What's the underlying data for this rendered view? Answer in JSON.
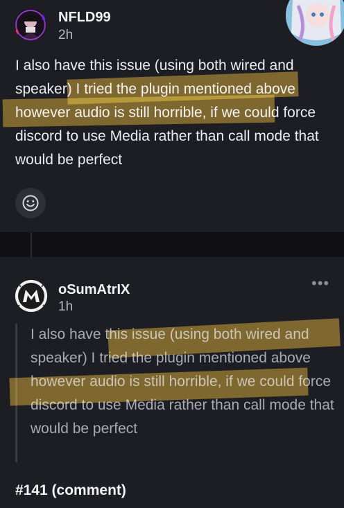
{
  "post1": {
    "username": "NFLD99",
    "time": "2h",
    "body": "I also have this issue (using both wired and speaker) I tried the plugin mentioned above however audio is still horrible, if we could force discord to use Media rather than call mode that would be perfect"
  },
  "post2": {
    "username": "oSumAtrIX",
    "time": "1h",
    "quote": "I also have this issue (using both wired and speaker) I tried the plugin mentioned above however audio is still horrible, if we could force discord to use Media rather than call mode that would be perfect",
    "more_icon": "more-icon"
  },
  "footer": {
    "issue": "#141 (comment)"
  },
  "icons": {
    "reaction": "smile-icon"
  },
  "colors": {
    "highlight": "#c99919",
    "card": "#1d1e23",
    "background": "#0d0d10"
  }
}
